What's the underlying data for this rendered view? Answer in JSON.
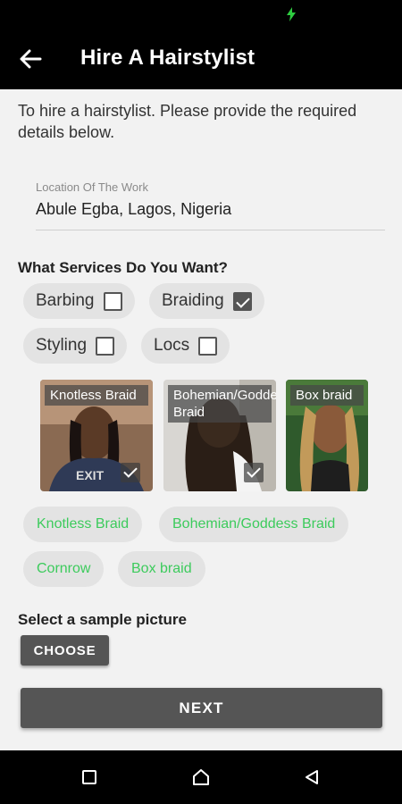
{
  "app_bar": {
    "title": "Hire A Hairstylist",
    "back_icon": "arrow-left-icon"
  },
  "intro_text": "To hire a hairstylist. Please provide the required details below.",
  "location": {
    "label": "Location Of The Work",
    "value": "Abule Egba, Lagos, Nigeria"
  },
  "services": {
    "title": "What Services Do You Want?",
    "options": [
      {
        "label": "Barbing",
        "checked": false
      },
      {
        "label": "Braiding",
        "checked": true
      },
      {
        "label": "Styling",
        "checked": false
      },
      {
        "label": "Locs",
        "checked": false
      }
    ]
  },
  "styles": [
    {
      "caption": "Knotless Braid",
      "selected": true
    },
    {
      "caption": "Bohemian/Goddess Braid",
      "selected": true
    },
    {
      "caption": "Box braid",
      "selected": false
    }
  ],
  "tags": [
    "Knotless Braid",
    "Bohemian/Goddess Braid",
    "Cornrow",
    "Box braid"
  ],
  "sample": {
    "title": "Select a sample picture",
    "choose_label": "CHOOSE"
  },
  "next_label": "NEXT",
  "colors": {
    "app_bar": "#000000",
    "background": "#f2f2f2",
    "tag_text": "#3ccb5c",
    "button": "#555555",
    "status_bolt": "#2ecc40"
  },
  "nav": {
    "recents_icon": "square-icon",
    "home_icon": "circle-home-icon",
    "back_icon": "triangle-back-icon"
  }
}
